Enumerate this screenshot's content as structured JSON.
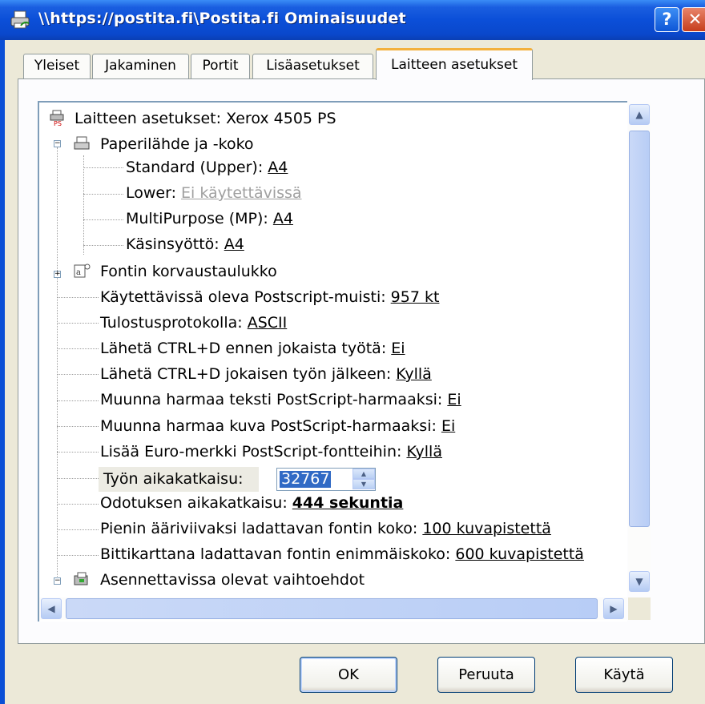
{
  "window": {
    "title": "\\\\https://postita.fi\\Postita.fi Ominaisuudet",
    "help_button": "?",
    "close_button": "✕"
  },
  "tabs": [
    {
      "label": "Yleiset"
    },
    {
      "label": "Jakaminen"
    },
    {
      "label": "Portit"
    },
    {
      "label": "Lisäasetukset"
    },
    {
      "label": "Laitteen asetukset",
      "active": true
    }
  ],
  "tree": {
    "root_label": "Laitteen asetukset: Xerox 4505 PS",
    "paper_source": {
      "label": "Paperilähde ja -koko",
      "items": [
        {
          "label": "Standard (Upper): ",
          "value": "A4"
        },
        {
          "label": "Lower: ",
          "value": "Ei käytettävissä",
          "disabled": true
        },
        {
          "label": "MultiPurpose (MP): ",
          "value": "A4"
        },
        {
          "label": "Käsinsyöttö: ",
          "value": "A4"
        }
      ]
    },
    "font_table_label": "Fontin korvaustaulukko",
    "settings": [
      {
        "label": "Käytettävissä oleva Postscript-muisti: ",
        "value": "957 kt"
      },
      {
        "label": "Tulostusprotokolla: ",
        "value": "ASCII"
      },
      {
        "label": "Lähetä CTRL+D ennen jokaista työtä: ",
        "value": "Ei"
      },
      {
        "label": "Lähetä CTRL+D jokaisen työn jälkeen: ",
        "value": "Kyllä"
      },
      {
        "label": "Muunna harmaa teksti PostScript-harmaaksi: ",
        "value": "Ei"
      },
      {
        "label": "Muunna harmaa kuva PostScript-harmaaksi: ",
        "value": "Ei"
      },
      {
        "label": "Lisää Euro-merkki PostScript-fontteihin: ",
        "value": "Kyllä"
      }
    ],
    "timeout": {
      "label": "Työn aikakatkaisu:",
      "value": "32767"
    },
    "settings2": [
      {
        "label": "Odotuksen aikakatkaisu: ",
        "value": "444 sekuntia"
      },
      {
        "label": "Pienin ääriviivaksi ladattavan fontin koko: ",
        "value": "100 kuvapistettä"
      },
      {
        "label": "Bittikarttana ladattavan fontin enimmäiskoko: ",
        "value": "600 kuvapistettä"
      }
    ],
    "installable_label": "Asennettavissa olevat vaihtoehdot"
  },
  "buttons": {
    "ok": "OK",
    "cancel": "Peruuta",
    "apply": "Käytä"
  },
  "colors": {
    "titlebar": "#0a4fd6",
    "selection": "#316ac5",
    "tab_highlight": "#f3b03c",
    "dialog_bg": "#ECE9D8"
  }
}
